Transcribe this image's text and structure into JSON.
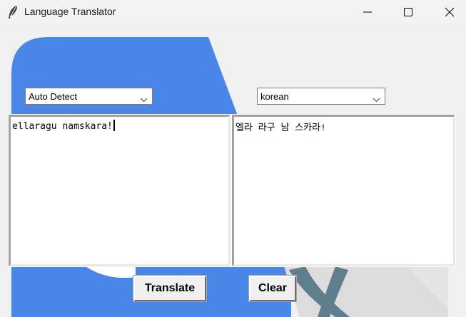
{
  "window": {
    "title": "Language Translator",
    "app_icon": "feather-icon",
    "controls": [
      "minimize-icon",
      "maximize-icon",
      "close-icon"
    ]
  },
  "source_language": {
    "selected": "Auto Detect"
  },
  "target_language": {
    "selected": "korean"
  },
  "source_text": "ellaragu namskara!",
  "translated_text": "엘라 라구 남 스카라!",
  "buttons": {
    "translate": "Translate",
    "clear": "Clear"
  },
  "colors": {
    "accent_blue": "#4a86e8",
    "slate": "#5f7f8f",
    "window_bg": "#f0f0f0"
  }
}
